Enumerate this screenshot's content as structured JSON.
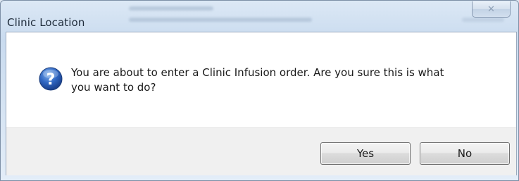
{
  "window": {
    "title": "Clinic Location",
    "close_glyph": "✕"
  },
  "dialog": {
    "icon": "question-icon",
    "message": "You are about to enter a Clinic Infusion order.  Are you sure this is what you want to do?"
  },
  "buttons": {
    "yes_label": "Yes",
    "no_label": "No"
  },
  "colors": {
    "icon_blue": "#2a5db0",
    "button_band": "#f0f0f0",
    "client_bg": "#ffffff"
  }
}
